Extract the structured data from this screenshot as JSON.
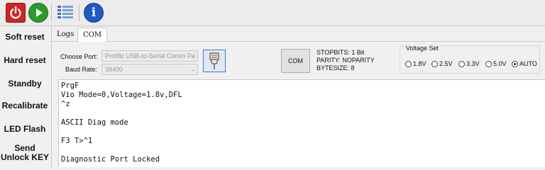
{
  "toolbar": {
    "power_icon": "power-icon",
    "play_icon": "play-icon",
    "list_icon": "list-icon",
    "info_icon": "info-icon",
    "info_glyph": "i"
  },
  "sidebar": {
    "items": [
      {
        "label": "Soft reset"
      },
      {
        "label": "Hard reset"
      },
      {
        "label": "Standby"
      },
      {
        "label": "Recalibrate"
      },
      {
        "label": "LED Flash"
      },
      {
        "label": "Send\nUnlock KEY"
      }
    ]
  },
  "tabs": [
    {
      "label": "Logs",
      "active": false
    },
    {
      "label": "COM",
      "active": true
    }
  ],
  "settings": {
    "port_label": "Choose Port:",
    "port_value": "Prolific USB-to-Serial Comm Po",
    "baud_label": "Baud Rate:",
    "baud_value": "38400",
    "comset_label": "COM SET",
    "stopbits": "STOPBITS: 1 Bit",
    "parity": "PARITY: NOPARITY",
    "bytesize": "BYTESIZE: 8"
  },
  "voltage": {
    "title": "Voltage Set",
    "options": [
      {
        "label": "1.8V",
        "selected": false
      },
      {
        "label": "2.5V",
        "selected": false
      },
      {
        "label": "3.3V",
        "selected": false
      },
      {
        "label": "5.0V",
        "selected": false
      },
      {
        "label": "AUTO",
        "selected": true
      }
    ]
  },
  "console": {
    "lines": [
      "PrgF",
      "Vio Mode=0,Voltage=1.8v,DFL",
      "^z",
      "",
      "ASCII Diag mode",
      "",
      "F3 T>^1",
      "",
      "Diagnostic Port Locked"
    ]
  }
}
